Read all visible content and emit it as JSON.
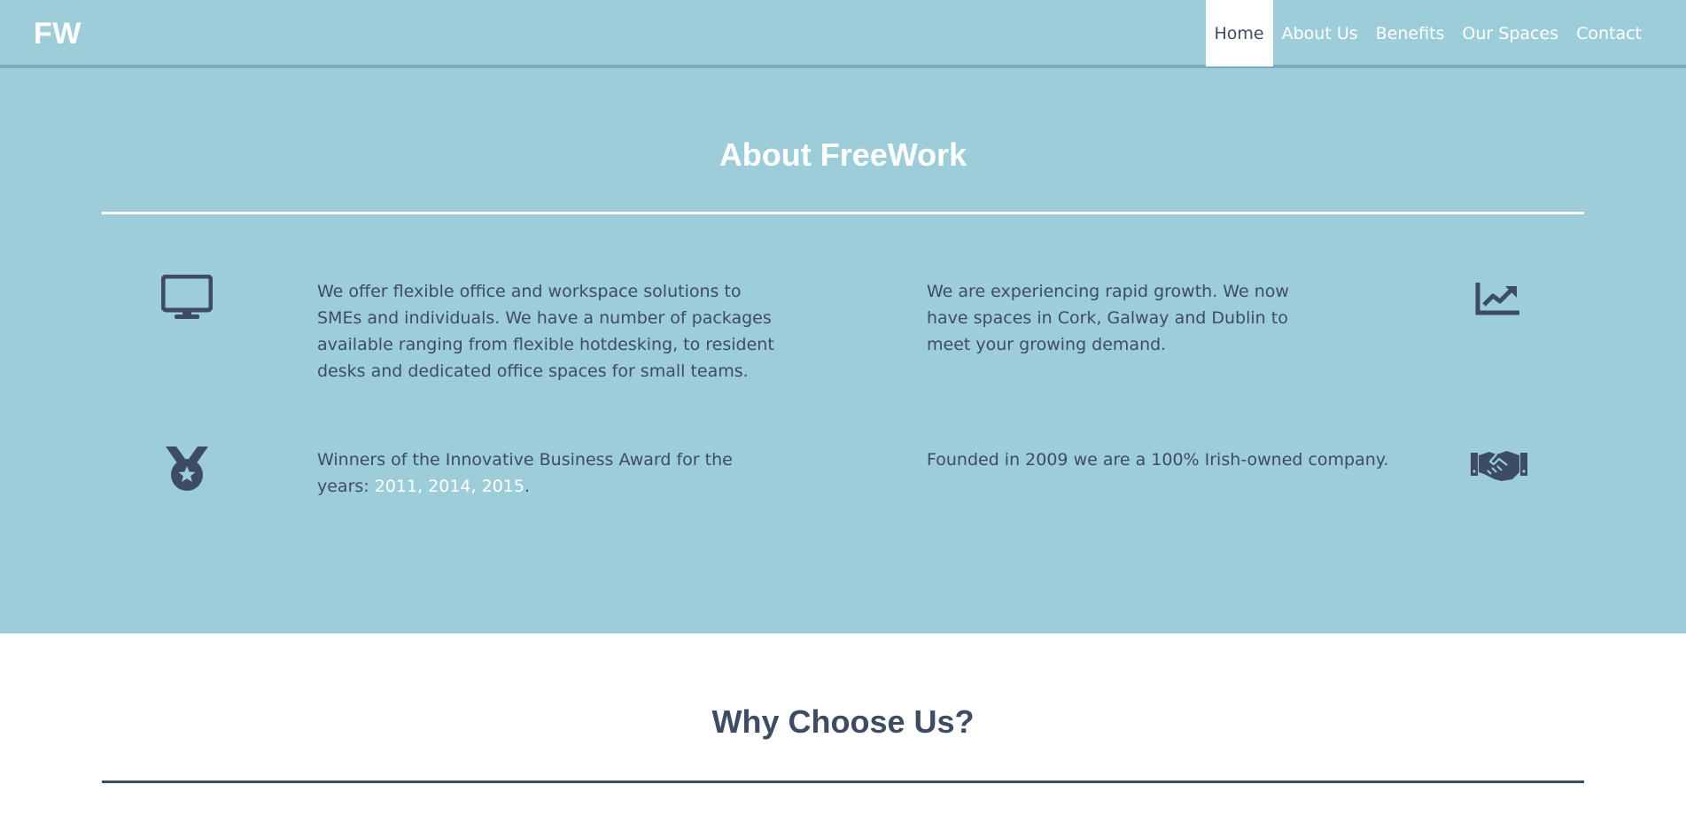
{
  "nav": {
    "brand": "FW",
    "links": [
      {
        "label": "Home",
        "active": true
      },
      {
        "label": "About Us",
        "active": false
      },
      {
        "label": "Benefits",
        "active": false
      },
      {
        "label": "Our Spaces",
        "active": false
      },
      {
        "label": "Contact",
        "active": false
      }
    ]
  },
  "about": {
    "title": "About FreeWork",
    "features": [
      {
        "icon": "desktop-monitor-icon",
        "text": "We offer flexible office and workspace solutions to SMEs and individuals. We have a number of packages available ranging from flexible hotdesking, to resident desks and dedicated office spaces for small teams."
      },
      {
        "icon": "growth-chart-icon",
        "text": "We are experiencing rapid growth. We now have spaces in Cork, Galway and Dublin to meet your growing demand."
      },
      {
        "icon": "award-medal-icon",
        "text_before": "Winners of the Innovative Business Award for the years: ",
        "years": "2011, 2014, 2015",
        "text_after": "."
      },
      {
        "icon": "handshake-icon",
        "text": "Founded in 2009 we are a 100% Irish-owned company."
      }
    ]
  },
  "why": {
    "title": "Why Choose Us?"
  },
  "colors": {
    "primary_bg": "#9dcdd9",
    "text_dark": "#3d4c63",
    "white": "#ffffff"
  }
}
